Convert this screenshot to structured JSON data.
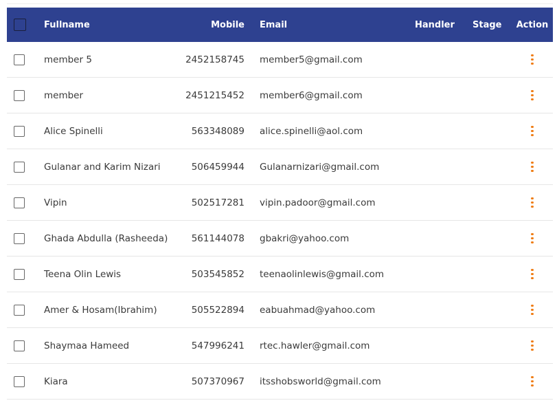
{
  "colors": {
    "header_background": "#2e4190",
    "action_icon": "#ef7d16"
  },
  "table": {
    "columns": {
      "fullname": "Fullname",
      "mobile": "Mobile",
      "email": "Email",
      "handler": "Handler",
      "stage": "Stage",
      "action": "Action"
    },
    "rows": [
      {
        "fullname": "member 5",
        "mobile": "2452158745",
        "email": "member5@gmail.com",
        "handler": "",
        "stage": ""
      },
      {
        "fullname": "member",
        "mobile": "2451215452",
        "email": "member6@gmail.com",
        "handler": "",
        "stage": ""
      },
      {
        "fullname": "Alice Spinelli",
        "mobile": "563348089",
        "email": "alice.spinelli@aol.com",
        "handler": "",
        "stage": ""
      },
      {
        "fullname": "Gulanar and Karim Nizari",
        "mobile": "506459944",
        "email": "Gulanarnizari@gmail.com",
        "handler": "",
        "stage": ""
      },
      {
        "fullname": "Vipin",
        "mobile": "502517281",
        "email": "vipin.padoor@gmail.com",
        "handler": "",
        "stage": ""
      },
      {
        "fullname": "Ghada Abdulla (Rasheeda)",
        "mobile": "561144078",
        "email": "gbakri@yahoo.com",
        "handler": "",
        "stage": ""
      },
      {
        "fullname": "Teena Olin Lewis",
        "mobile": "503545852",
        "email": "teenaolinlewis@gmail.com",
        "handler": "",
        "stage": ""
      },
      {
        "fullname": "Amer & Hosam(Ibrahim)",
        "mobile": "505522894",
        "email": "eabuahmad@yahoo.com",
        "handler": "",
        "stage": ""
      },
      {
        "fullname": "Shaymaa Hameed",
        "mobile": "547996241",
        "email": "rtec.hawler@gmail.com",
        "handler": "",
        "stage": ""
      },
      {
        "fullname": "Kiara",
        "mobile": "507370967",
        "email": "itsshobsworld@gmail.com",
        "handler": "",
        "stage": ""
      }
    ]
  }
}
